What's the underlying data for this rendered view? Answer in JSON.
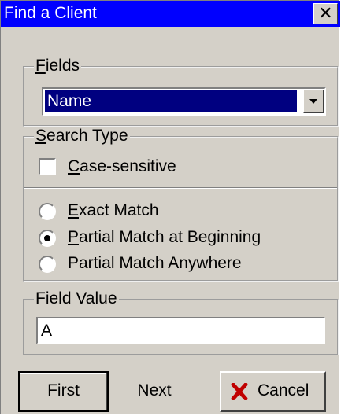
{
  "window": {
    "title": "Find a Client",
    "close_glyph": "✕"
  },
  "fields": {
    "group_label": "Fields",
    "selected": "Name"
  },
  "search_type": {
    "group_label": "Search Type",
    "case_sensitive": {
      "label": "Case-sensitive",
      "checked": false
    },
    "options": [
      {
        "label": "Exact Match",
        "selected": false
      },
      {
        "label": "Partial Match at Beginning",
        "selected": true
      },
      {
        "label": "Partial Match Anywhere",
        "selected": false
      }
    ]
  },
  "field_value": {
    "group_label": "Field Value",
    "value": "A"
  },
  "buttons": {
    "first": "First",
    "next": "Next",
    "cancel": "Cancel"
  },
  "colors": {
    "titlebar": "#0000ff",
    "selection": "#000080",
    "face": "#d4d0c8",
    "cancel_x": "#c00000"
  }
}
